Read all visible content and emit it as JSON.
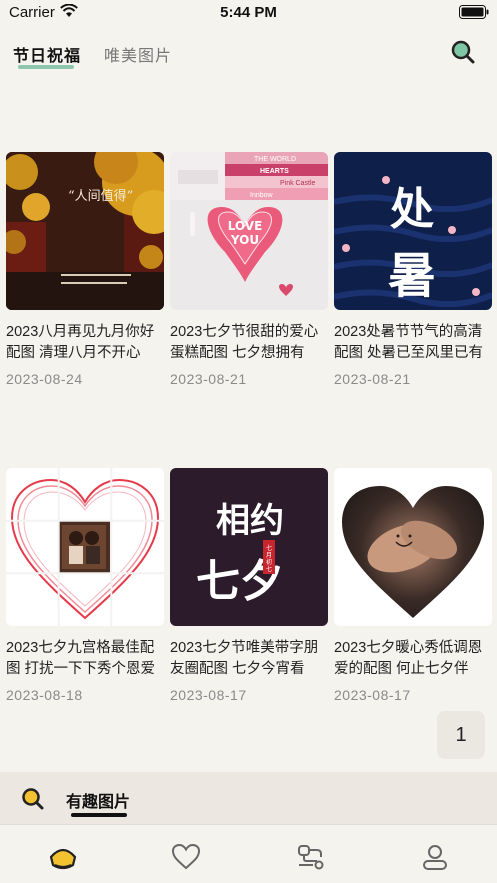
{
  "status_bar": {
    "carrier": "Carrier",
    "time": "5:44 PM"
  },
  "tabs": [
    {
      "label": "节日祝福",
      "active": true
    },
    {
      "label": "唯美图片",
      "active": false
    }
  ],
  "cards": [
    {
      "title": "2023八月再见九月你好配图 清理八月不开心的...",
      "date": "2023-08-24",
      "thumb": "ginkgo-wall"
    },
    {
      "title": "2023七夕节很甜的爱心蛋糕配图 七夕想拥有一...",
      "date": "2023-08-21",
      "thumb": "love-you-cake"
    },
    {
      "title": "2023处暑节节气的高清配图 处暑已至风里已有秋...",
      "date": "2023-08-21",
      "thumb": "chushu-poster"
    },
    {
      "title": "2023七夕九宫格最佳配图 打扰一下下秀个恩爱",
      "date": "2023-08-18",
      "thumb": "heart-grid"
    },
    {
      "title": "2023七夕节唯美带字朋友圈配图 七夕今宵看碧...",
      "date": "2023-08-17",
      "thumb": "qixi-calligraphy"
    },
    {
      "title": "2023七夕暖心秀低调恩爱的配图 何止七夕伴你...",
      "date": "2023-08-17",
      "thumb": "hands-heart"
    }
  ],
  "pagination": {
    "current_page": "1"
  },
  "bottom_section": {
    "label": "有趣图片"
  },
  "tabbar": [
    {
      "name": "home",
      "icon": "house-icon",
      "active": true
    },
    {
      "name": "favorites",
      "icon": "heart-icon",
      "active": false
    },
    {
      "name": "discover",
      "icon": "route-icon",
      "active": false
    },
    {
      "name": "profile",
      "icon": "user-icon",
      "active": false
    }
  ],
  "thumb_text": {
    "ginkgo_quote": "“人间值得”",
    "cake_line1": "LOVE",
    "cake_line2": "YOU",
    "cake_box1": "THE WORLD",
    "cake_box2": "HEARTS",
    "cake_box3": "Pink Castle",
    "cake_box4": "Innbow",
    "chushu_chars": "处暑",
    "qixi_chars_top": "相约",
    "qixi_chars_bottom": "七夕",
    "qixi_seal": "七月初七"
  },
  "colors": {
    "accent": "#8fc7ad",
    "background": "#f5f3ee",
    "active_icon": "#f2c230"
  }
}
